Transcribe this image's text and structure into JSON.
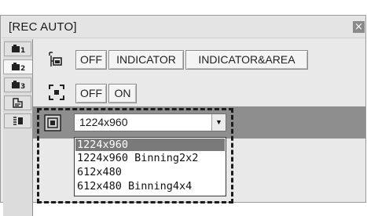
{
  "window": {
    "title": "[REC AUTO]",
    "close_glyph": "×"
  },
  "tabs": [
    {
      "label": "1",
      "icon": "camera-1-icon"
    },
    {
      "label": "2",
      "icon": "camera-2-icon"
    },
    {
      "label": "3",
      "icon": "camera-3-icon"
    },
    {
      "label": "",
      "icon": "tools-icon"
    },
    {
      "label": "",
      "icon": "display-setting-icon"
    }
  ],
  "row1": {
    "icon": "indicator-mode-icon",
    "buttons": [
      "OFF",
      "INDICATOR",
      "INDICATOR&AREA"
    ]
  },
  "row2": {
    "icon": "focus-area-icon",
    "buttons": [
      "OFF",
      "ON"
    ]
  },
  "resolution": {
    "icon": "resolution-icon",
    "selected": "1224x960",
    "options": [
      "1224x960",
      "1224x960 Binning2x2",
      "612x480",
      "612x480 Binning4x4"
    ],
    "highlighted_index": 0
  },
  "colors": {
    "band": "#8e8e8e",
    "selection": "#7a7a7a",
    "panel": "#e9e9e9"
  }
}
